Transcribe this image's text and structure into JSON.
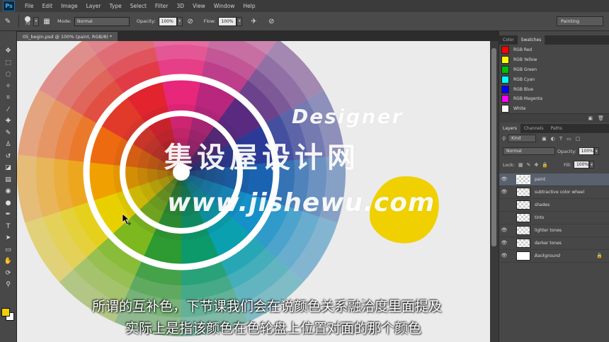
{
  "app": {
    "logo": "Ps"
  },
  "menu": [
    "File",
    "Edit",
    "Image",
    "Layer",
    "Type",
    "Select",
    "Filter",
    "3D",
    "View",
    "Window",
    "Help"
  ],
  "options": {
    "brush_size": "70",
    "mode_label": "Mode:",
    "mode_value": "Normal",
    "opacity_label": "Opacity:",
    "opacity_value": "100%",
    "flow_label": "Flow:",
    "flow_value": "100%",
    "workspace": "Painting"
  },
  "document": {
    "tab_title": "05_begin.psd @ 100% (paint, RGB/8) *"
  },
  "watermark": {
    "designer": "Designer",
    "chinese": "集设屋设计网",
    "url": "www.jishewu.com"
  },
  "subtitles": {
    "line1": "所谓的互补色，下节课我们会在说颜色关系融洽度里面提及",
    "line2": "实际上是指该颜色在色轮盘上位置对面的那个颜色"
  },
  "swatches_panel": {
    "tabs": [
      "Color",
      "Swatches"
    ],
    "items": [
      {
        "name": "RGB Red",
        "color": "#ff0000"
      },
      {
        "name": "RGB Yellow",
        "color": "#ffff00"
      },
      {
        "name": "RGB Green",
        "color": "#00c000"
      },
      {
        "name": "RGB Cyan",
        "color": "#00ffff"
      },
      {
        "name": "RGB Blue",
        "color": "#0000ff"
      },
      {
        "name": "RGB Magenta",
        "color": "#ff00ff"
      },
      {
        "name": "White",
        "color": "#ffffff"
      }
    ]
  },
  "layers_panel": {
    "tabs": [
      "Layers",
      "Channels",
      "Paths"
    ],
    "kind_label": "Kind",
    "blend_mode": "Normal",
    "opacity_label": "Opacity:",
    "opacity_value": "100%",
    "lock_label": "Lock:",
    "fill_label": "Fill:",
    "fill_value": "100%",
    "layers": [
      {
        "name": "paint",
        "visible": true,
        "selected": true
      },
      {
        "name": "subtractive color wheel",
        "visible": true,
        "selected": false
      },
      {
        "name": "shades",
        "visible": false,
        "selected": false
      },
      {
        "name": "tints",
        "visible": false,
        "selected": false
      },
      {
        "name": "lighter tones",
        "visible": true,
        "selected": false
      },
      {
        "name": "darker tones",
        "visible": true,
        "selected": false
      },
      {
        "name": "Background",
        "visible": true,
        "selected": false
      }
    ]
  },
  "colors": {
    "paint_blob": "#f0d000",
    "foreground": "#f0d000",
    "background": "#ffffff",
    "selected_layer": "#59606e"
  }
}
